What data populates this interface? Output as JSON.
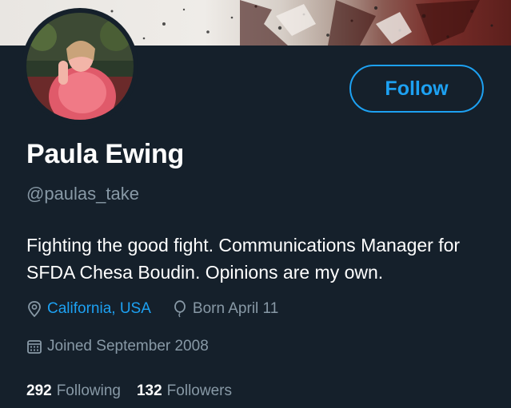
{
  "profile": {
    "name": "Paula Ewing",
    "handle": "@paulas_take",
    "bio": "Fighting the good fight. Communications Manager for SFDA Chesa Boudin. Opinions are my own.",
    "location": "California, USA",
    "birthday": "Born April 11",
    "joined": "Joined September 2008"
  },
  "actions": {
    "follow_label": "Follow"
  },
  "stats": {
    "following_count": "292",
    "following_label": "Following",
    "followers_count": "132",
    "followers_label": "Followers"
  },
  "icons": {
    "location": "location-pin-icon",
    "birthday": "balloon-icon",
    "joined": "calendar-icon"
  },
  "colors": {
    "background": "#15202b",
    "accent": "#1da1f2",
    "secondary_text": "#8899a6"
  }
}
